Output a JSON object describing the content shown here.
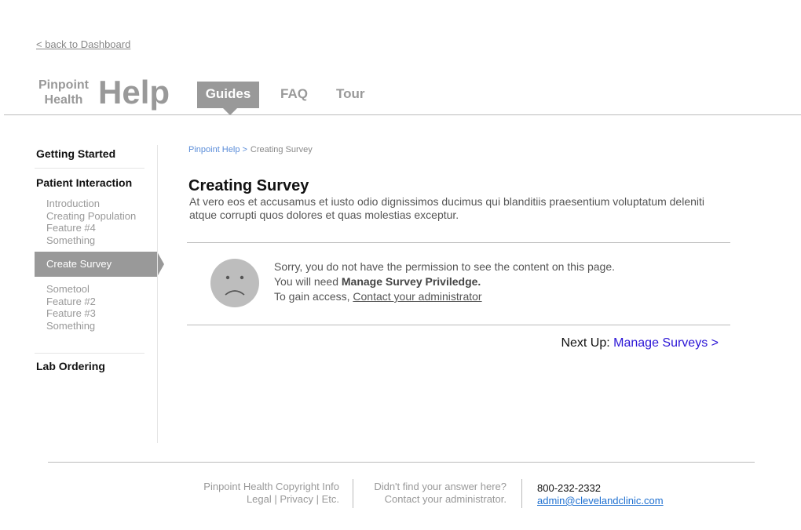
{
  "header": {
    "back_link": "< back to Dashboard",
    "logo_line1": "Pinpoint",
    "logo_line2": "Health",
    "title": "Help",
    "tabs": [
      {
        "label": "Guides",
        "active": true
      },
      {
        "label": "FAQ",
        "active": false
      },
      {
        "label": "Tour",
        "active": false
      }
    ]
  },
  "sidebar": {
    "getting_started": "Getting Started",
    "patient_interaction": "Patient Interaction",
    "group1": [
      "Introduction",
      "Creating Population",
      "Feature #4",
      "Something"
    ],
    "active_item": "Create Survey",
    "group2": [
      "Sometool",
      "Feature #2",
      "Feature #3",
      "Something"
    ],
    "lab_ordering": "Lab Ordering"
  },
  "breadcrumb": {
    "root": "Pinpoint Help >",
    "current": "Creating Survey"
  },
  "main": {
    "title": "Creating Survey",
    "description": "At vero eos et accusamus et iusto odio dignissimos ducimus qui blanditiis praesentium voluptatum deleniti atque corrupti quos dolores et quas molestias exceptur.",
    "permission": {
      "line1": "Sorry, you do not have the permission to see the content on this page.",
      "line2_prefix": "You will need",
      "line2_bold": "Manage Survey Priviledge.",
      "line3_prefix": "To gain access,",
      "line3_link": "Contact your administrator"
    },
    "next_up_label": "Next Up:",
    "next_up_link": "Manage Surveys >"
  },
  "footer": {
    "copyright": "Pinpoint Health Copyright Info",
    "legal": "Legal",
    "privacy": "Privacy",
    "etc": "Etc.",
    "question": "Didn't find your answer here?",
    "contact": "Contact your administrator.",
    "phone": "800-232-2332",
    "email": "admin@clevelandclinic.com"
  },
  "colors": {
    "accent_gray": "#999999",
    "breadcrumb_link": "#5b8dd9",
    "next_link": "#2a14d6",
    "email_link": "#1d6fd0"
  }
}
